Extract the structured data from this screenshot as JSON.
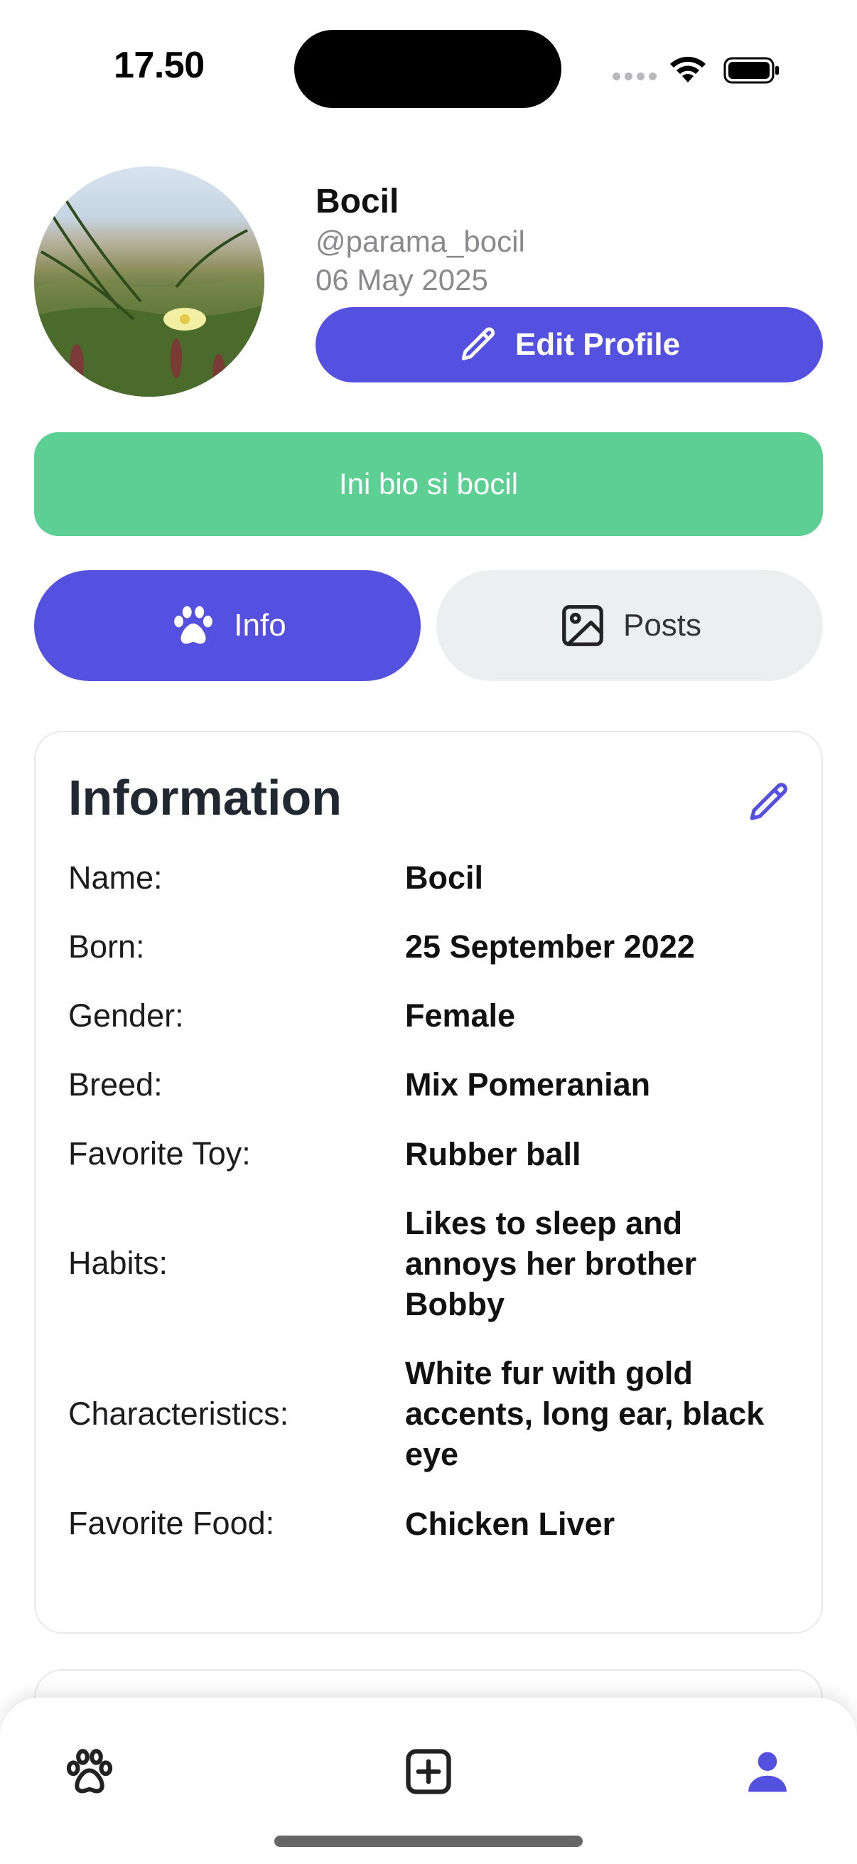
{
  "status_bar": {
    "time": "17.50"
  },
  "profile": {
    "name": "Bocil",
    "handle": "@parama_bocil",
    "date": "06 May 2025",
    "edit_profile_label": "Edit Profile",
    "bio": "Ini bio si bocil"
  },
  "tabs": [
    {
      "label": "Info",
      "icon": "paw-icon",
      "active": true
    },
    {
      "label": "Posts",
      "icon": "image-icon",
      "active": false
    }
  ],
  "information": {
    "title": "Information",
    "rows": [
      {
        "label": "Name:",
        "value": "Bocil"
      },
      {
        "label": "Born:",
        "value": "25 September 2022"
      },
      {
        "label": "Gender:",
        "value": "Female"
      },
      {
        "label": "Breed:",
        "value": "Mix Pomeranian"
      },
      {
        "label": "Favorite Toy:",
        "value": "Rubber ball"
      },
      {
        "label": "Habits:",
        "value": "Likes to sleep and annoys her brother Bobby"
      },
      {
        "label": "Characteristics:",
        "value": "White fur with gold accents, long ear, black eye"
      },
      {
        "label": "Favorite Food:",
        "value": "Chicken Liver"
      }
    ]
  },
  "bottom_nav": [
    {
      "icon": "paw-outline-icon",
      "active": false
    },
    {
      "icon": "add-square-icon",
      "active": false
    },
    {
      "icon": "person-icon",
      "active": true
    }
  ],
  "colors": {
    "accent": "#5450e0",
    "bio_background": "#5ecf93",
    "inactive_tab": "#eceff0",
    "secondary_text": "#8a8a8e"
  }
}
